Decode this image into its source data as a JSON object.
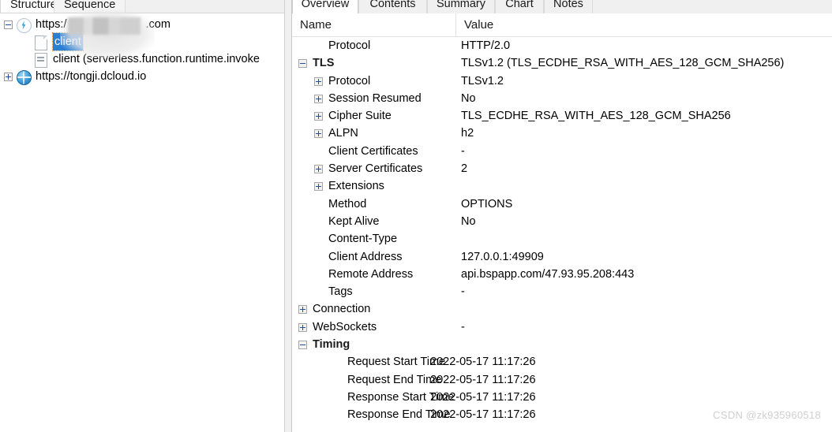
{
  "left_panel": {
    "tabs": [
      {
        "label": "Structure",
        "active": true
      },
      {
        "label": "Sequence",
        "active": false
      }
    ],
    "tree": [
      {
        "label": "https:/",
        "label_suffix": ".com",
        "icon": "lightning-bolt-icon",
        "expander": "minus",
        "redacted": true,
        "selected": false,
        "indent": 0
      },
      {
        "label": "client",
        "icon": "page-icon",
        "expander": "none",
        "selected": true,
        "indent": 1
      },
      {
        "label": "client (serverless.function.runtime.invoke",
        "icon": "page-lines-icon",
        "expander": "none",
        "selected": false,
        "indent": 1
      },
      {
        "label": "https://tongji.dcloud.io",
        "icon": "globe-icon",
        "expander": "plus",
        "selected": false,
        "indent": 0
      }
    ]
  },
  "right_panel": {
    "tabs": [
      {
        "label": "Overview",
        "active": true
      },
      {
        "label": "Contents",
        "active": false
      },
      {
        "label": "Summary",
        "active": false
      },
      {
        "label": "Chart",
        "active": false
      },
      {
        "label": "Notes",
        "active": false
      }
    ],
    "columns": {
      "name": "Name",
      "value": "Value"
    },
    "rows": [
      {
        "name": "Protocol",
        "value": "HTTP/2.0",
        "indent": 1,
        "expander": "none",
        "bold": false
      },
      {
        "name": "TLS",
        "value": "TLSv1.2 (TLS_ECDHE_RSA_WITH_AES_128_GCM_SHA256)",
        "indent": 0,
        "expander": "minus",
        "bold": true
      },
      {
        "name": "Protocol",
        "value": "TLSv1.2",
        "indent": 1,
        "expander": "plus",
        "bold": false
      },
      {
        "name": "Session Resumed",
        "value": "No",
        "indent": 1,
        "expander": "plus",
        "bold": false
      },
      {
        "name": "Cipher Suite",
        "value": "TLS_ECDHE_RSA_WITH_AES_128_GCM_SHA256",
        "indent": 1,
        "expander": "plus",
        "bold": false
      },
      {
        "name": "ALPN",
        "value": "h2",
        "indent": 1,
        "expander": "plus",
        "bold": false
      },
      {
        "name": "Client Certificates",
        "value": "-",
        "indent": 1,
        "expander": "none",
        "bold": false
      },
      {
        "name": "Server Certificates",
        "value": "2",
        "indent": 1,
        "expander": "plus",
        "bold": false
      },
      {
        "name": "Extensions",
        "value": "",
        "indent": 1,
        "expander": "plus",
        "bold": false
      },
      {
        "name": "Method",
        "value": "OPTIONS",
        "indent": 1,
        "expander": "none",
        "bold": false
      },
      {
        "name": "Kept Alive",
        "value": "No",
        "indent": 1,
        "expander": "none",
        "bold": false
      },
      {
        "name": "Content-Type",
        "value": "",
        "indent": 1,
        "expander": "none",
        "bold": false
      },
      {
        "name": "Client Address",
        "value": "127.0.0.1:49909",
        "indent": 1,
        "expander": "none",
        "bold": false
      },
      {
        "name": "Remote Address",
        "value": "api.bspapp.com/47.93.95.208:443",
        "indent": 1,
        "expander": "none",
        "bold": false
      },
      {
        "name": "Tags",
        "value": "-",
        "indent": 1,
        "expander": "none",
        "bold": false
      },
      {
        "name": "Connection",
        "value": "",
        "indent": 0,
        "expander": "plus",
        "bold": false
      },
      {
        "name": "WebSockets",
        "value": "-",
        "indent": 0,
        "expander": "plus",
        "bold": false
      },
      {
        "name": "Timing",
        "value": "",
        "indent": 0,
        "expander": "minus",
        "bold": true
      },
      {
        "name": "Request Start Time",
        "value": "2022-05-17 11:17:26",
        "indent": 2,
        "expander": "none",
        "bold": false
      },
      {
        "name": "Request End Time",
        "value": "2022-05-17 11:17:26",
        "indent": 2,
        "expander": "none",
        "bold": false
      },
      {
        "name": "Response Start Time",
        "value": "2022-05-17 11:17:26",
        "indent": 2,
        "expander": "none",
        "bold": false
      },
      {
        "name": "Response End Time",
        "value": "2022-05-17 11:17:26",
        "indent": 2,
        "expander": "none",
        "bold": false
      }
    ]
  },
  "watermark": {
    "text": "CSDN @zk935960518"
  },
  "colors": {
    "selection_blue": "#2a7fd4",
    "expander_blue": "#234f9b",
    "tab_inactive_bg": "#f0f0f0",
    "watermark_gray": "#cfcfcf"
  }
}
